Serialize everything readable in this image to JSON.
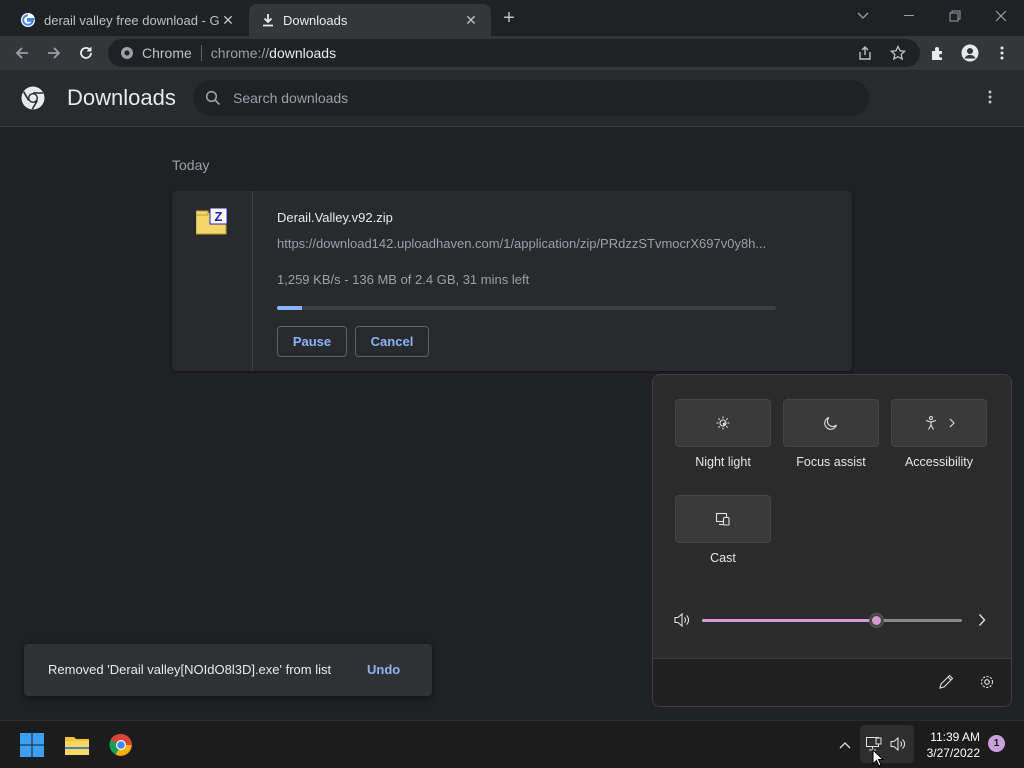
{
  "browser": {
    "tabs": [
      {
        "title": "derail valley free download - Goo",
        "icon": "google-icon",
        "active": false
      },
      {
        "title": "Downloads",
        "icon": "download-icon",
        "active": true
      }
    ],
    "omnibox": {
      "chip": "Chrome",
      "url_scheme": "chrome://",
      "url_host": "downloads"
    }
  },
  "downloads": {
    "title": "Downloads",
    "search_placeholder": "Search downloads",
    "section_label": "Today",
    "item": {
      "file_name": "Derail.Valley.v92.zip",
      "url": "https://download142.uploadhaven.com/1/application/zip/PRdzzSTvmocrX697v0y8h...",
      "status": "1,259 KB/s - 136 MB of 2.4 GB, 31 mins left",
      "progress_fraction": 0.05,
      "pause_label": "Pause",
      "cancel_label": "Cancel",
      "file_icon": "winzip-icon"
    },
    "toast": {
      "text": "Removed 'Derail valley[NOIdO8l3D].exe' from list",
      "action": "Undo"
    }
  },
  "quick_settings": {
    "tiles": [
      {
        "label": "Night light",
        "icon": "night-light-icon"
      },
      {
        "label": "Focus assist",
        "icon": "moon-icon"
      },
      {
        "label": "Accessibility",
        "icon": "accessibility-icon"
      },
      {
        "label": "Cast",
        "icon": "cast-icon"
      }
    ],
    "volume_level": 0.67,
    "accent_color": "#d39ad7"
  },
  "taskbar": {
    "time": "11:39 AM",
    "date": "3/27/2022",
    "notification_count": "1"
  }
}
